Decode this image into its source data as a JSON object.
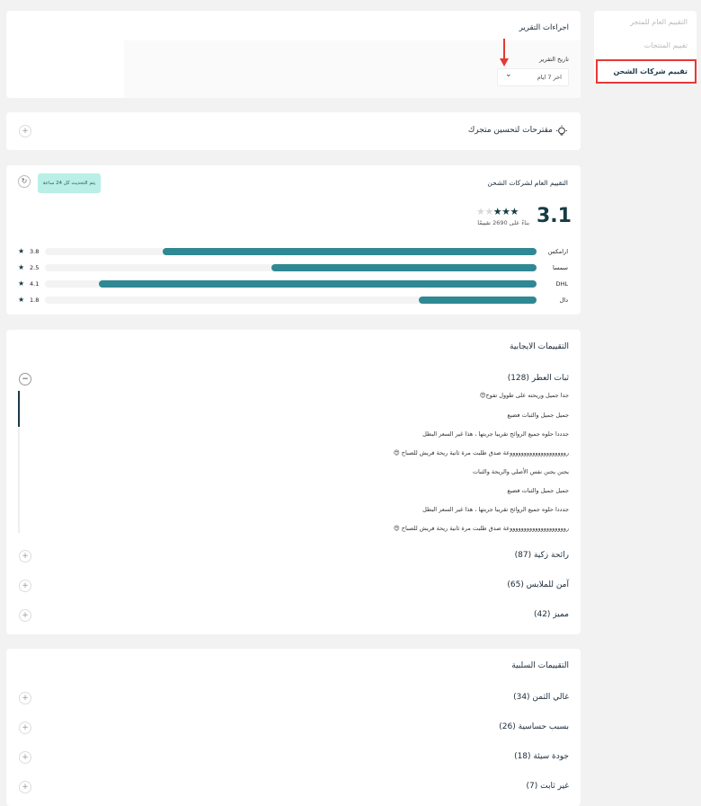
{
  "sidebar": {
    "items": [
      {
        "label": "التقييم العام للمتجر"
      },
      {
        "label": "تقييم المنتجات"
      },
      {
        "label": "تقييم شركات الشحن"
      }
    ]
  },
  "report": {
    "title": "اجراءات التقرير",
    "date_label": "تاريخ التقرير",
    "date_value": "اخر 7 ايام"
  },
  "suggestions": {
    "title": "مقترحات لتحسين متجرك"
  },
  "rating": {
    "title": "التقييم العام لشركات الشحن",
    "tooltip": "يتم التحديث كل 24 ساعة",
    "score": "3.1",
    "based_on": "بناءً على 2690 تقييمًا",
    "stars": 3,
    "companies": [
      {
        "name": "ارامكس",
        "value": "3.8",
        "fraction": 0.76
      },
      {
        "name": "سمسا",
        "value": "2.5",
        "fraction": 0.54
      },
      {
        "name": "DHL",
        "value": "4.1",
        "fraction": 0.89
      },
      {
        "name": "دال",
        "value": "1.8",
        "fraction": 0.24
      }
    ]
  },
  "positive": {
    "title": "التقييمات الايجابية",
    "groups": [
      {
        "label": "ثبات العطر (128)",
        "comments": [
          "جدا جميل وريحته على طوول تفوح😍",
          "جميل جميل والثبات فضيع",
          "جدددا حلوه جميع الروائح تقريبا جربتها ، هذا غير السعر البطل",
          "رووووووووووووووووووووعة صدق طلبت مرة ثانية ريحة فريش للصباح 😍",
          "يجنن يجنن نفس الأصلي والريحة والثبات",
          "جميل جميل والثبات فضيع",
          "جدددا حلوه جميع الروائح تقريبا جربتها ، هذا غير السعر البطل",
          "رووووووووووووووووووووعة صدق طلبت مرة ثانية ريحة فريش للصباح 😍"
        ]
      },
      {
        "label": "رائحة زكية (87)"
      },
      {
        "label": "آمن للملابس (65)"
      },
      {
        "label": "مميز (42)"
      }
    ]
  },
  "negative": {
    "title": "التقييمات السلبية",
    "groups": [
      {
        "label": "غالي الثمن (34)"
      },
      {
        "label": "بسبب حساسية (26)"
      },
      {
        "label": "جودة سيئة (18)"
      },
      {
        "label": "غير ثابت (7)"
      }
    ]
  },
  "icons": {
    "plus": "+",
    "minus": "−",
    "chevron": "⌄",
    "refresh": "↻",
    "star": "★"
  },
  "colors": {
    "accent": "#2f8893",
    "active_border": "#e53935",
    "tooltip_bg": "#b9efe6",
    "star_filled": "#173b45",
    "star_empty": "#d8d8d8"
  }
}
